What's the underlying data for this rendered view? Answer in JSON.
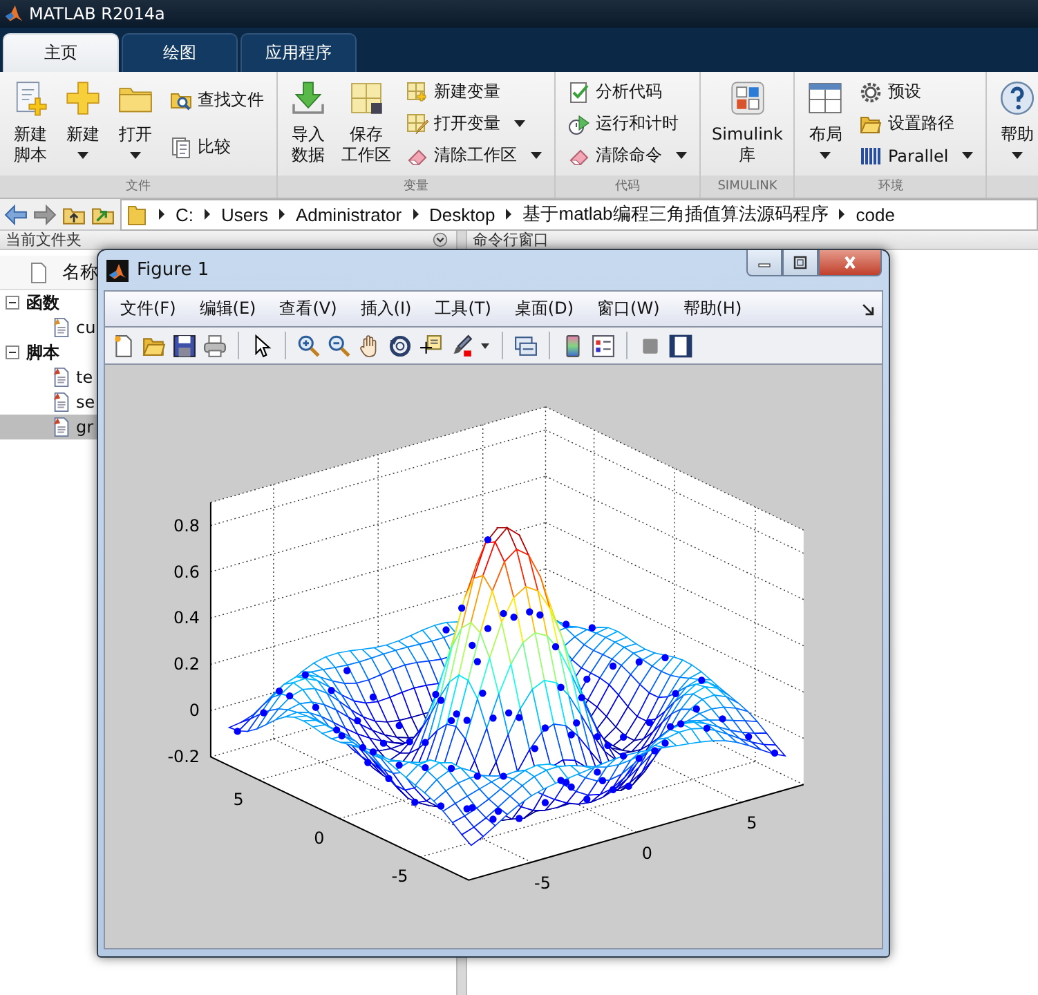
{
  "app_title": "MATLAB R2014a",
  "tabs": [
    {
      "label": "主页",
      "selected": true
    },
    {
      "label": "绘图",
      "selected": false
    },
    {
      "label": "应用程序",
      "selected": false
    }
  ],
  "toolstrip": [
    {
      "label": "文件",
      "items": [
        {
          "kind": "large",
          "lines": [
            "新建",
            "脚本"
          ],
          "dropdown": false
        },
        {
          "kind": "large",
          "lines": [
            "新建"
          ],
          "dropdown": true
        },
        {
          "kind": "large",
          "lines": [
            "打开"
          ],
          "dropdown": true
        },
        {
          "kind": "stack",
          "rows": [
            {
              "label": "查找文件",
              "dropdown": false
            },
            {
              "label": "比较",
              "dropdown": false
            }
          ]
        }
      ]
    },
    {
      "label": "变量",
      "items": [
        {
          "kind": "large",
          "lines": [
            "导入",
            "数据"
          ],
          "dropdown": false
        },
        {
          "kind": "large",
          "lines": [
            "保存",
            "工作区"
          ],
          "dropdown": false
        },
        {
          "kind": "stack",
          "rows": [
            {
              "label": "新建变量",
              "dropdown": false
            },
            {
              "label": "打开变量",
              "dropdown": true
            },
            {
              "label": "清除工作区",
              "dropdown": true
            }
          ]
        }
      ]
    },
    {
      "label": "代码",
      "items": [
        {
          "kind": "stack",
          "rows": [
            {
              "label": "分析代码",
              "dropdown": false
            },
            {
              "label": "运行和计时",
              "dropdown": false
            },
            {
              "label": "清除命令",
              "dropdown": true
            }
          ]
        }
      ]
    },
    {
      "label": "SIMULINK",
      "items": [
        {
          "kind": "large",
          "lines": [
            "Simulink",
            "库"
          ],
          "dropdown": false
        }
      ]
    },
    {
      "label": "环境",
      "items": [
        {
          "kind": "large",
          "lines": [
            "布局"
          ],
          "dropdown": true
        },
        {
          "kind": "stack",
          "rows": [
            {
              "label": "预设",
              "dropdown": false
            },
            {
              "label": "设置路径",
              "dropdown": false
            },
            {
              "label": "Parallel",
              "dropdown": true
            }
          ]
        }
      ]
    },
    {
      "items": [
        {
          "kind": "large",
          "lines": [
            "帮助"
          ],
          "dropdown": true
        },
        {
          "kind": "icons"
        }
      ]
    }
  ],
  "path": {
    "crumbs": [
      "C:",
      "Users",
      "Administrator",
      "Desktop",
      "基于matlab编程三角插值算法源码程序",
      "code"
    ]
  },
  "current_folder": {
    "title": "当前文件夹",
    "column": "名称",
    "tree": [
      {
        "label": "函数",
        "expanded": true,
        "children": [
          {
            "label": "cu",
            "selected": false
          }
        ]
      },
      {
        "label": "脚本",
        "expanded": true,
        "children": [
          {
            "label": "te",
            "selected": false
          },
          {
            "label": "se",
            "selected": false
          },
          {
            "label": "gr",
            "selected": true
          }
        ]
      }
    ]
  },
  "command_window": {
    "title": "命令行窗口"
  },
  "figure": {
    "title": "Figure 1",
    "menu": [
      "文件(F)",
      "编辑(E)",
      "查看(V)",
      "插入(I)",
      "工具(T)",
      "桌面(D)",
      "窗口(W)",
      "帮助(H)"
    ],
    "plot": {
      "z_ticks": [
        "0.8",
        "0.6",
        "0.4",
        "0.2",
        "0",
        "-0.2"
      ],
      "x_ticks": [
        "5",
        "0",
        "-5"
      ],
      "y_ticks": [
        "-5",
        "0",
        "5"
      ]
    }
  }
}
